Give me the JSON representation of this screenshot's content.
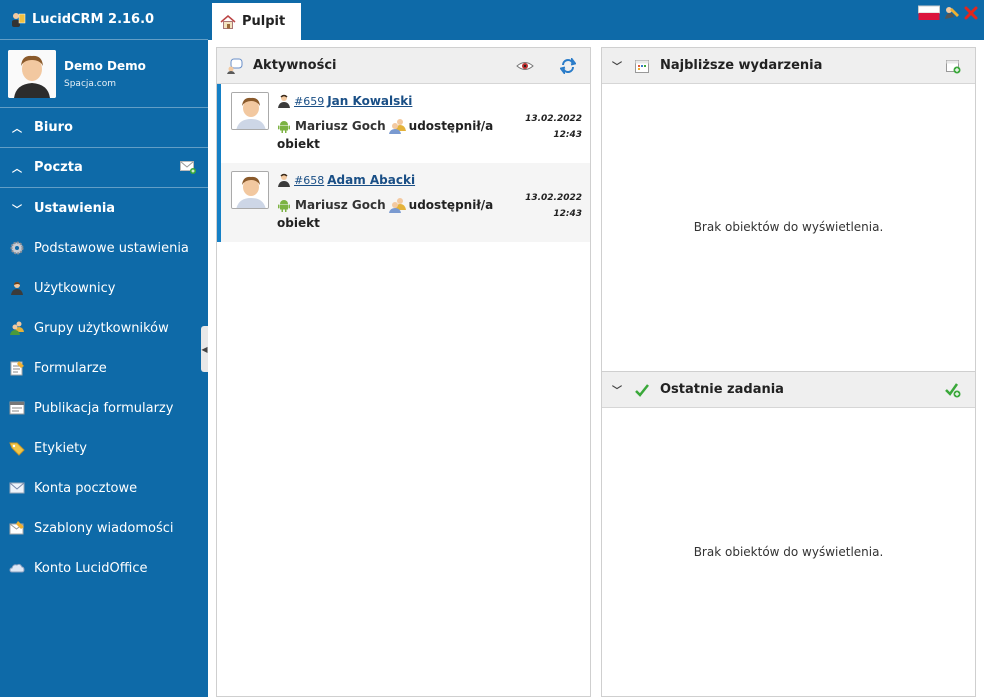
{
  "app": {
    "title": "LucidCRM 2.16.0"
  },
  "user": {
    "name": "Demo Demo",
    "company": "Spacja.com"
  },
  "sidebar": {
    "sections": [
      {
        "label": "Biuro",
        "chevron": "up"
      },
      {
        "label": "Poczta",
        "chevron": "up"
      },
      {
        "label": "Ustawienia",
        "chevron": "down"
      }
    ],
    "items": [
      {
        "label": "Podstawowe ustawienia",
        "icon": "gear-icon"
      },
      {
        "label": "Użytkownicy",
        "icon": "user-icon"
      },
      {
        "label": "Grupy użytkowników",
        "icon": "users-icon"
      },
      {
        "label": "Formularze",
        "icon": "form-icon"
      },
      {
        "label": "Publikacja formularzy",
        "icon": "publish-icon"
      },
      {
        "label": "Etykiety",
        "icon": "tag-icon"
      },
      {
        "label": "Konta pocztowe",
        "icon": "mail-account-icon"
      },
      {
        "label": "Szablony wiadomości",
        "icon": "template-icon"
      },
      {
        "label": "Konto LucidOffice",
        "icon": "cloud-icon"
      }
    ]
  },
  "tabs": [
    {
      "label": "Pulpit"
    }
  ],
  "activities": {
    "title": "Aktywności",
    "items": [
      {
        "num": "#659",
        "name": "Jan Kowalski",
        "user": "Mariusz Goch",
        "verb": "udostępnił/a",
        "object": "obiekt",
        "date": "13.02.2022",
        "time": "12:43"
      },
      {
        "num": "#658",
        "name": "Adam Abacki",
        "user": "Mariusz Goch",
        "verb": "udostępnił/a",
        "object": "obiekt",
        "date": "13.02.2022",
        "time": "12:43"
      }
    ]
  },
  "events": {
    "title": "Najbliższe wydarzenia",
    "empty": "Brak obiektów do wyświetlenia."
  },
  "tasks": {
    "title": "Ostatnie zadania",
    "empty": "Brak obiektów do wyświetlenia."
  },
  "colors": {
    "primary": "#0e6aa8",
    "accent": "#1580c6",
    "link": "#1a4f86"
  }
}
